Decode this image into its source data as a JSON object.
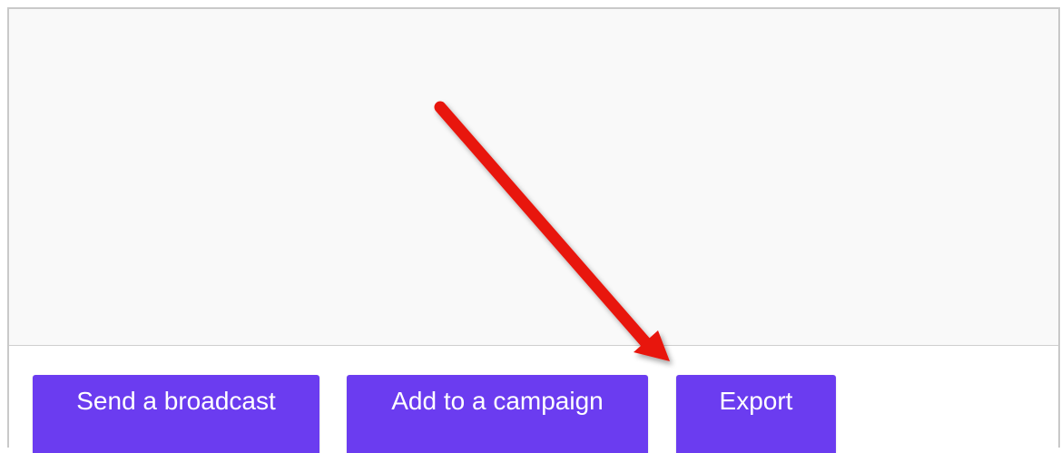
{
  "actions": {
    "send_broadcast_label": "Send a broadcast",
    "add_to_campaign_label": "Add to a campaign",
    "export_label": "Export"
  },
  "colors": {
    "button_purple": "#6b3cf0",
    "annotation_red": "#e8150c",
    "panel_background": "#f9f9f9"
  },
  "annotation": {
    "icon": "red-arrow-pointing-to-export"
  }
}
